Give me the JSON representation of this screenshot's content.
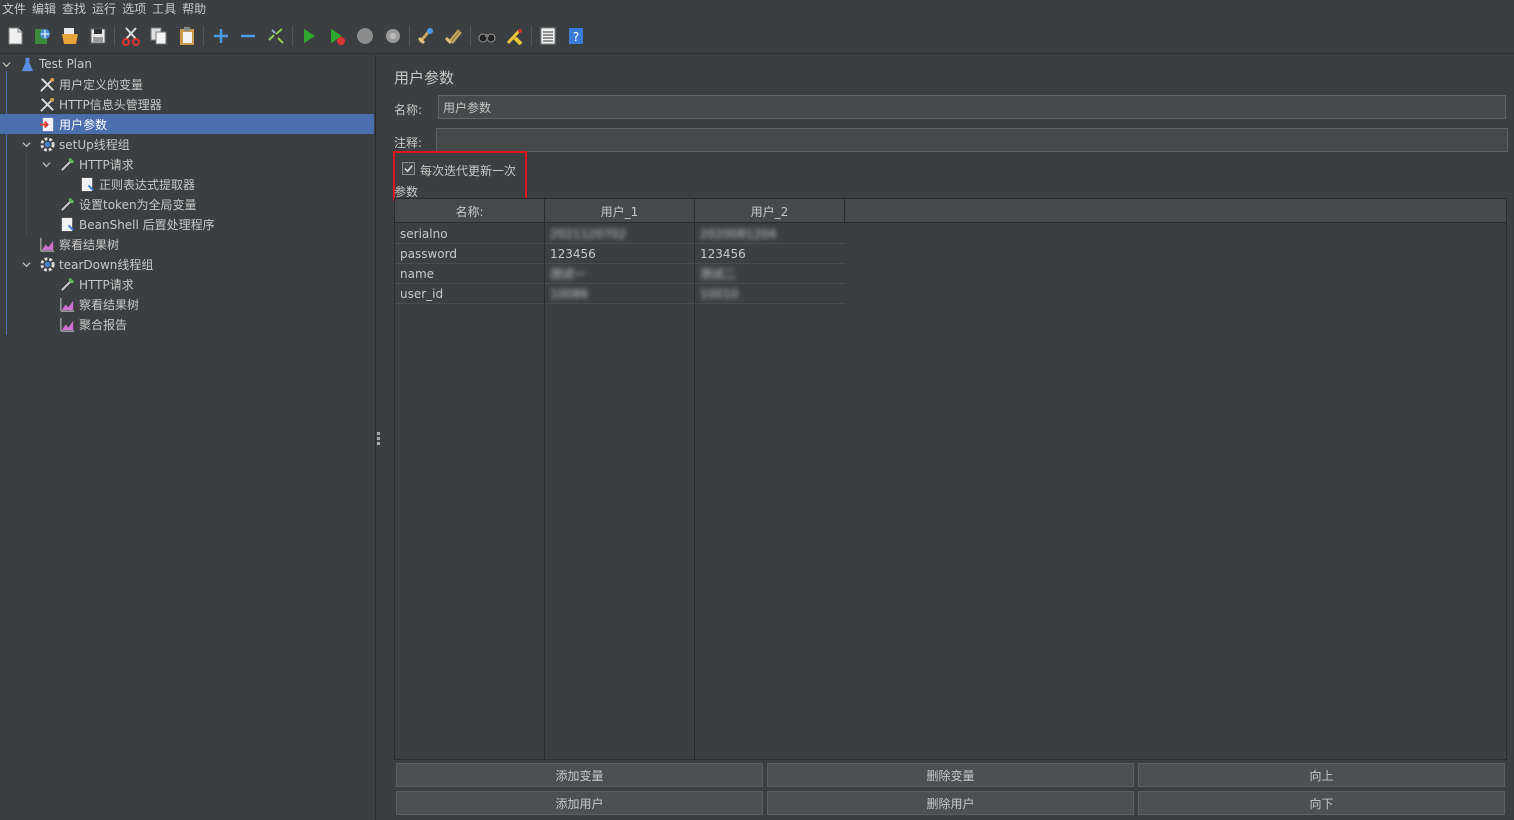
{
  "menu": [
    "文件",
    "编辑",
    "查找",
    "运行",
    "选项",
    "工具",
    "帮助"
  ],
  "toolbar_icons": [
    "new-icon",
    "templates-icon",
    "open-icon",
    "save-icon",
    "cut-icon",
    "copy-icon",
    "paste-icon",
    "expand-icon",
    "collapse-icon",
    "toggle-icon",
    "start-icon",
    "start-no-pause-icon",
    "stop-icon",
    "shutdown-icon",
    "clear-icon",
    "clear-all-icon",
    "search-icon",
    "reset-search-icon",
    "function-helper-icon",
    "help-icon"
  ],
  "tree": {
    "test_plan": "Test Plan",
    "user_defined_vars": "用户定义的变量",
    "http_header_manager": "HTTP信息头管理器",
    "user_params": "用户参数",
    "setup_group": "setUp线程组",
    "http_request_1": "HTTP请求",
    "regex_extractor": "正则表达式提取器",
    "set_token": "设置token为全局变量",
    "beanshell": "BeanShell 后置处理程序",
    "view_results_tree_1": "察看结果树",
    "teardown_group": "tearDown线程组",
    "http_request_2": "HTTP请求",
    "view_results_tree_2": "察看结果树",
    "aggregate_report": "聚合报告"
  },
  "panel": {
    "title": "用户参数",
    "name_label": "名称:",
    "name_value": "用户参数",
    "comment_label": "注释:",
    "comment_value": "",
    "checkbox_label": "每次迭代更新一次",
    "checkbox_checked": true,
    "params_label": "参数"
  },
  "table": {
    "headers": [
      "名称:",
      "用户_1",
      "用户_2"
    ],
    "rows": [
      {
        "name": "serialno",
        "u1": "2021120702",
        "u2": "2020081204"
      },
      {
        "name": "password",
        "u1": "123456",
        "u2": "123456"
      },
      {
        "name": "name",
        "u1": "测试一",
        "u2": "测试二"
      },
      {
        "name": "user_id",
        "u1": "10086",
        "u2": "10010"
      }
    ]
  },
  "buttons": {
    "add_var": "添加变量",
    "del_var": "删除变量",
    "up": "向上",
    "add_user": "添加用户",
    "del_user": "删除用户",
    "down": "向下"
  },
  "colors": {
    "background": "#3c3f41",
    "selection": "#4b6eaf",
    "highlight_box": "#e0141e"
  }
}
